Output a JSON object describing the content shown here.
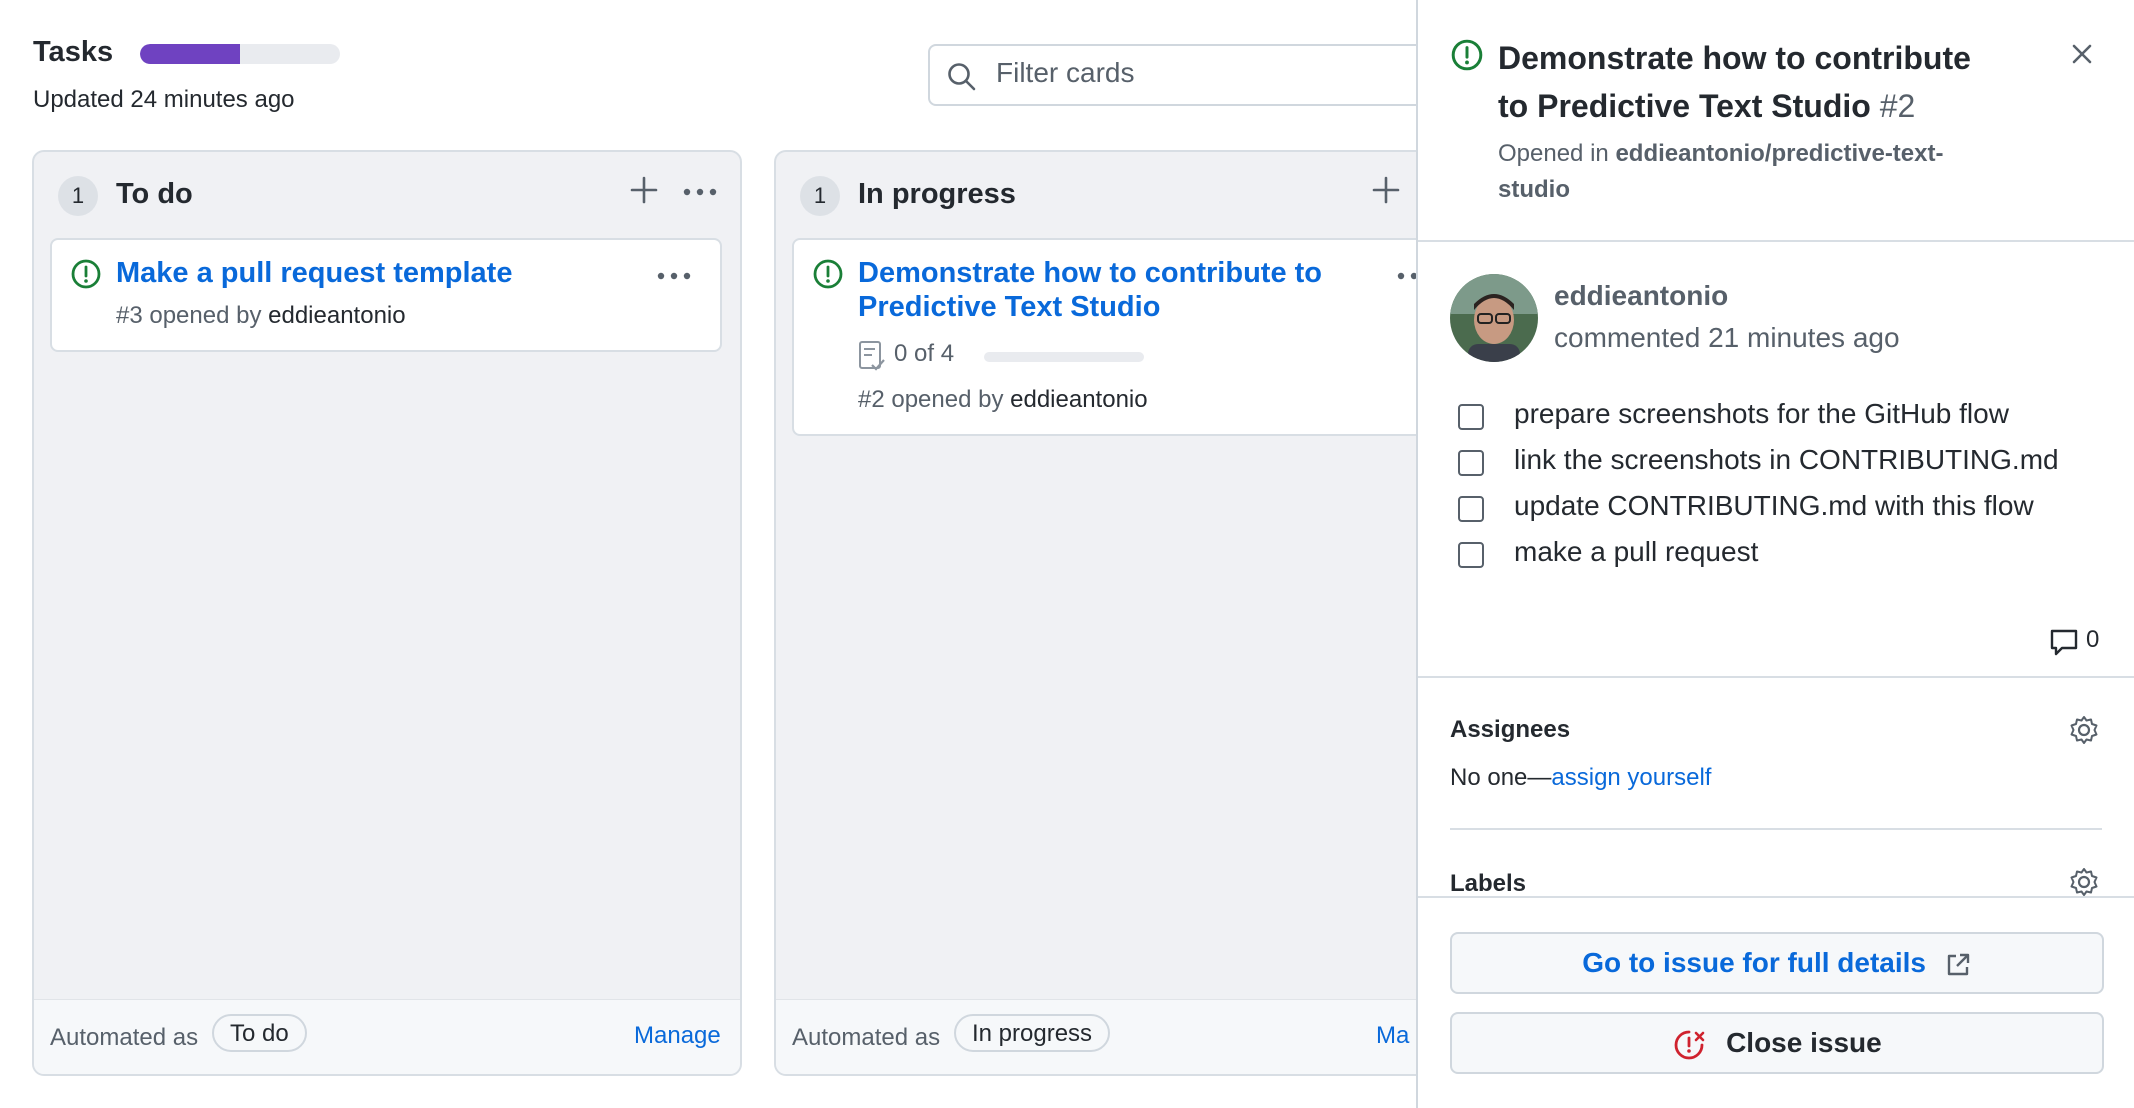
{
  "project": {
    "title": "Tasks",
    "progress": 0.5,
    "progress_color": "#6f42c1",
    "updated": "Updated 24 minutes ago"
  },
  "filter": {
    "placeholder": "Filter cards"
  },
  "columns": [
    {
      "count": "1",
      "name": "To do",
      "automated_label": "Automated as",
      "automated_value": "To do",
      "manage_label": "Manage",
      "cards": [
        {
          "title": "Make a pull request template",
          "meta_prefix": "#3 opened by",
          "author": "eddieantonio"
        }
      ]
    },
    {
      "count": "1",
      "name": "In progress",
      "automated_label": "Automated as",
      "automated_value": "In progress",
      "manage_label": "Ma",
      "cards": [
        {
          "title_line1": "Demonstrate how to contribute to",
          "title_line2": "Predictive Text Studio",
          "tasks_text": "0 of 4",
          "tasks_done": 0,
          "tasks_total": 4,
          "meta_prefix": "#2 opened by",
          "author": "eddieantonio"
        }
      ]
    }
  ],
  "panel": {
    "title_line1": "Demonstrate how to contribute",
    "title_line2": "to Predictive Text Studio",
    "number": "#2",
    "opened_prefix": "Opened in",
    "repo_line1": "eddieantonio/predictive-text-",
    "repo_line2": "studio",
    "commenter": "eddieantonio",
    "commented": "commented 21 minutes ago",
    "tasks": [
      "prepare screenshots for the GitHub flow",
      "link the screenshots in CONTRIBUTING.md",
      "update CONTRIBUTING.md with this flow",
      "make a pull request"
    ],
    "comment_count": "0",
    "assignees_heading": "Assignees",
    "assignees_none": "No one—",
    "assign_link": "assign yourself",
    "labels_heading": "Labels",
    "go_button": "Go to issue for full details",
    "close_button": "Close issue"
  },
  "colors": {
    "open_issue": "#1a7f37",
    "link": "#0969da",
    "close_red": "#cf222e"
  }
}
